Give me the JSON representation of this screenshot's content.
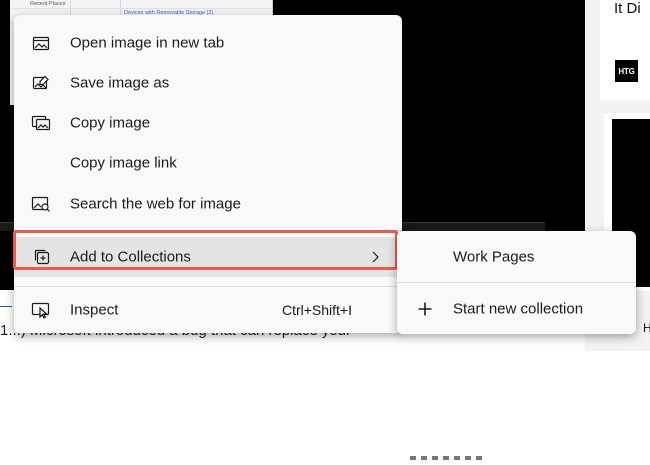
{
  "background": {
    "places_label": "Recent Places",
    "devices_label": "Devices with Removable Storage (2)",
    "right_snippet": "It Di",
    "logo_text": "HTG",
    "bottom_text": "1...) Microsoft introduced a bug that can replace your",
    "right_fragment": "H"
  },
  "context_menu": {
    "items": [
      {
        "label": "Open image in new tab",
        "icon": "open-image-icon"
      },
      {
        "label": "Save image as",
        "icon": "save-image-icon"
      },
      {
        "label": "Copy image",
        "icon": "copy-image-icon"
      },
      {
        "label": "Copy image link",
        "icon": ""
      },
      {
        "label": "Search the web for image",
        "icon": "search-image-icon"
      },
      {
        "label": "Add to Collections",
        "icon": "collections-icon",
        "submenu": true
      },
      {
        "label": "Inspect",
        "icon": "inspect-icon",
        "shortcut": "Ctrl+Shift+I"
      }
    ],
    "highlight_color": "#ef5b4b"
  },
  "collections_submenu": {
    "items": [
      {
        "label": "Work Pages"
      },
      {
        "label": "Start new collection",
        "icon": "plus-icon"
      }
    ]
  }
}
